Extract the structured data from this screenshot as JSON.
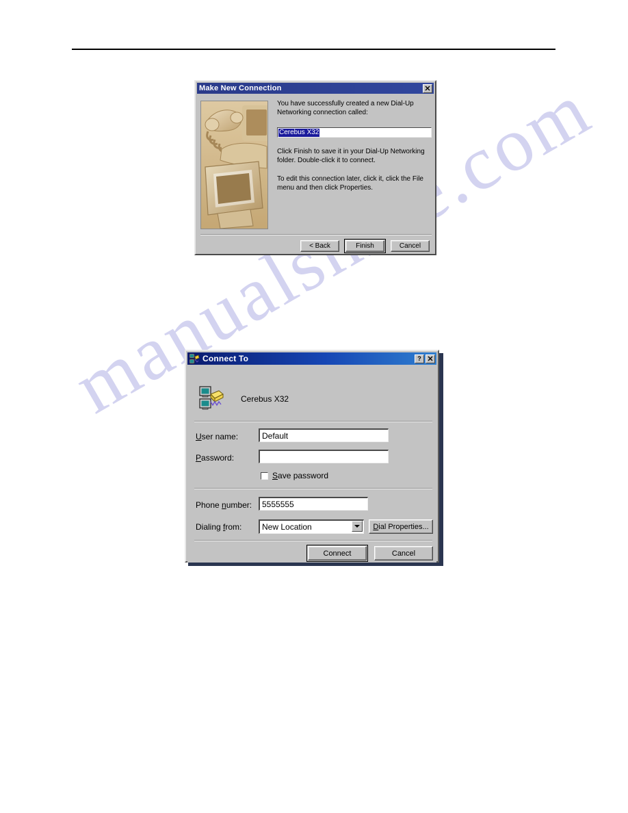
{
  "page": {
    "watermark_text": "manualshive.com",
    "watermark_color": "#ccccee"
  },
  "dialog1": {
    "title": "Make New Connection",
    "close_label": "✕",
    "close_icon_name": "close-icon",
    "paragraph1": "You have successfully created a new Dial-Up Networking connection called:",
    "connection_name_value": "Cerebus X32",
    "paragraph2": "Click Finish to save it in your Dial-Up Networking folder. Double-click it to connect.",
    "paragraph3": "To edit this connection later, click it, click the File menu and then click Properties.",
    "buttons": {
      "back": "< Back",
      "back_accel": "B",
      "finish": "Finish",
      "cancel": "Cancel"
    },
    "illustration_alt": "telephone-and-monitor-photo"
  },
  "dialog2": {
    "title": "Connect To",
    "help_label": "?",
    "close_label": "✕",
    "connection_name": "Cerebus X32",
    "fields": {
      "user_name_label": "User name:",
      "user_name_value": "Default",
      "password_label": "Password:",
      "password_value": "",
      "save_password_label": "Save password",
      "save_password_checked": false,
      "phone_number_label": "Phone number:",
      "phone_number_value": "5555555",
      "dialing_from_label": "Dialing from:",
      "dialing_from_value": "New Location",
      "dial_properties_label": "Dial Properties..."
    },
    "buttons": {
      "connect": "Connect",
      "cancel": "Cancel"
    }
  }
}
